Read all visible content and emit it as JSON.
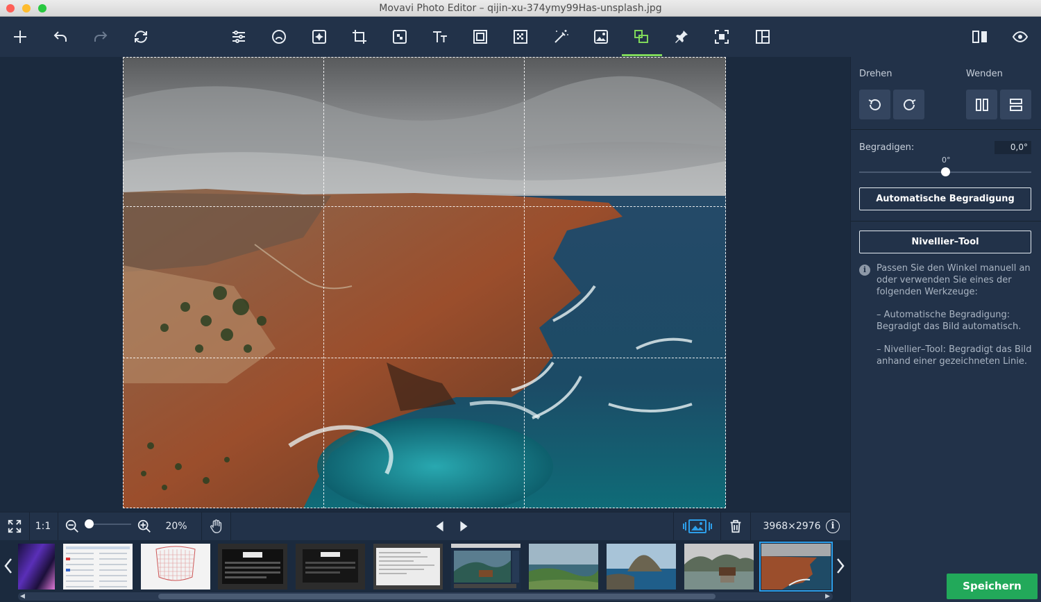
{
  "window": {
    "title": "Movavi Photo Editor – qijin-xu-374ymy99Has-unsplash.jpg"
  },
  "toolbar": {
    "left": [
      "add-icon",
      "undo-icon",
      "redo-icon",
      "reset-icon"
    ],
    "center": [
      "adjust-icon",
      "retouch-icon",
      "effects-icon",
      "crop-icon",
      "object-removal-icon",
      "text-icon",
      "frame-icon",
      "background-icon",
      "magic-wand-icon",
      "insert-image-icon",
      "rotate-icon",
      "pin-icon",
      "resize-icon",
      "layout-icon"
    ],
    "right": [
      "compare-icon",
      "preview-eye-icon"
    ],
    "active": "rotate-icon"
  },
  "panel": {
    "rotate_label": "Drehen",
    "flip_label": "Wenden",
    "straighten_label": "Begradigen:",
    "straighten_value": "0,0°",
    "slider_zero": "0°",
    "slider_fraction": 0.5,
    "auto_button": "Automatische Begradigung",
    "level_button": "Nivellier–Tool",
    "info_icon_glyph": "i",
    "info_lines": [
      "Passen Sie den Winkel manuell an oder verwenden Sie eines der folgenden Werkzeuge:",
      "– Automatische Begradigung: Begradigt das Bild automatisch.",
      "– Nivellier–Tool: Begradigt das Bild anhand einer gezeichneten Linie."
    ]
  },
  "bottombar": {
    "ratio_label": "1:1",
    "zoom_fraction": 0.05,
    "zoom_value": "20%",
    "dimensions": "3968×2976",
    "info_glyph": "i"
  },
  "filmstrip": {
    "selected_index": 10,
    "thumbs": [
      "purple-scene",
      "spreadsheet-doc",
      "sketch-doc",
      "dark-app-screen",
      "dark-app-screen-2",
      "document-window",
      "desktop-screenshot",
      "coastal-valley",
      "island-rocks",
      "lake-house",
      "coastal-cliffs"
    ]
  },
  "save_button": "Speichern",
  "colors": {
    "accent_green": "#22a95a",
    "active_tool": "#7fd85a",
    "selection_blue": "#2d9ee9",
    "background": "#1b2a3e",
    "toolbar": "#223249"
  }
}
